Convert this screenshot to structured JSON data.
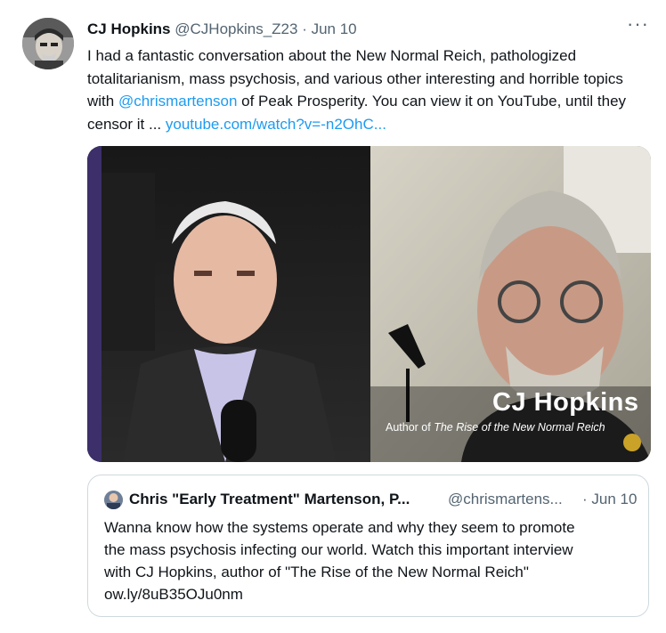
{
  "tweet": {
    "author_name": "CJ Hopkins",
    "author_handle": "@CJHopkins_Z23",
    "separator": " · ",
    "date": "Jun 10",
    "more_label": "···",
    "text_part1": "I had a fantastic conversation about the New Normal Reich, pathologized totalitarianism, mass psychosis, and various other interesting and horrible topics with ",
    "mention": "@chrismartenson",
    "text_part2": " of Peak Prosperity. You can view it on YouTube, until they censor it ... ",
    "url_text": "youtube.com/watch?v=-n2OhC..."
  },
  "media": {
    "caption_name": "CJ Hopkins",
    "caption_sub_prefix": "Author of ",
    "caption_sub_title": "The Rise of the New Normal Reich"
  },
  "quote": {
    "author_name": "Chris \"Early Treatment\" Martenson, P...",
    "author_handle": "@chrismartens...",
    "date": "· Jun 10",
    "text_lines": [
      "Wanna know how the systems operate and why they seem to promote",
      "the mass psychosis infecting our world. Watch this important interview",
      "with CJ Hopkins, author of \"The Rise of the New Normal Reich\"",
      "ow.ly/8uB35OJu0nm"
    ]
  },
  "colors": {
    "link": "#1d9bf0",
    "muted": "#536471",
    "text": "#0f1419",
    "border": "#cfd9de"
  }
}
